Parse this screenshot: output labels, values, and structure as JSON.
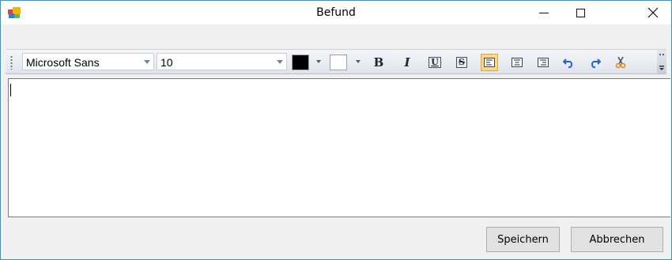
{
  "window": {
    "title": "Befund"
  },
  "toolbar": {
    "font_name": "Microsoft Sans",
    "font_size": "10",
    "fore_color": "#000000",
    "back_color": "#ffffff",
    "bold": "B",
    "italic": "I",
    "underline": "U",
    "strikethrough": "S",
    "align_active": "left"
  },
  "editor": {
    "content": ""
  },
  "footer": {
    "save_label": "Speichern",
    "cancel_label": "Abbrechen"
  },
  "colors": {
    "accent_border": "#2b9acb",
    "active_button": "#ffd88a"
  }
}
